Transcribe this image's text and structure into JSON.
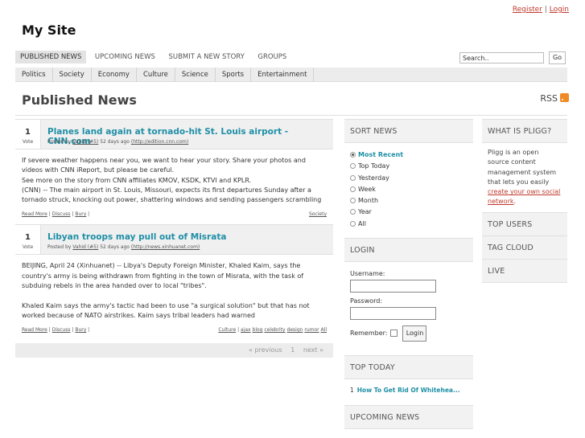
{
  "header": {
    "register_label": "Register",
    "separator": "|",
    "login_label": "Login",
    "site_name": "My Site"
  },
  "nav": {
    "items": [
      {
        "label": "PUBLISHED NEWS",
        "active": true
      },
      {
        "label": "UPCOMING NEWS",
        "active": false
      },
      {
        "label": "SUBMIT A NEW STORY",
        "active": false
      },
      {
        "label": "GROUPS",
        "active": false
      }
    ]
  },
  "search": {
    "value": "Search..",
    "go_label": "Go"
  },
  "categories": [
    "Politics",
    "Society",
    "Economy",
    "Culture",
    "Science",
    "Sports",
    "Entertainment"
  ],
  "page": {
    "title": "Published News",
    "rss_label": "RSS"
  },
  "stories": [
    {
      "votes": "1",
      "vote_label": "Vote",
      "title": "Planes land again at tornado-hit St. Louis airport - CNN.com",
      "meta_prefix": "Posted by",
      "author": "Vahid (#5)",
      "meta_time": "52 days ago",
      "source": "(http://edition.cnn.com)",
      "body": [
        "If severe weather happens near you, we want to hear your story. Share your photos and videos with CNN iReport, but please be careful.",
        "See more on the story from CNN affiliates KMOV, KSDK, KTVI and KPLR.",
        "(CNN) -- The main airport in St. Louis, Missouri, expects its first departures Sunday after a tornado struck, knocking out power, shattering windows and sending passengers scrambling for cover f"
      ],
      "links": [
        "Read More",
        "Discuss",
        "Bury"
      ],
      "right_links": [
        "Society"
      ]
    },
    {
      "votes": "1",
      "vote_label": "Vote",
      "title": "Libyan troops may pull out of Misrata",
      "meta_prefix": "Posted by",
      "author": "Vahid (#5)",
      "meta_time": "52 days ago",
      "source": "(http://news.xinhuanet.com)",
      "body": [
        "BEIJING, April 24 (Xinhuanet) -- Libya's Deputy Foreign Minister, Khaled Kaim, says the country's army is being withdrawn from fighting in the town of Misrata, with the task of subduing rebels in the area handed over to local \"tribes\".",
        "",
        "Khaled Kaim says the army's tactic had been to use \"a surgical solution\" but that has not worked because of NATO airstrikes. Kaim says tribal leaders had warned"
      ],
      "links": [
        "Read More",
        "Discuss",
        "Bury"
      ],
      "right_links": [
        "Culture",
        "ajax",
        "blog",
        "celebrity",
        "design",
        "rumor",
        "All"
      ]
    }
  ],
  "pager": {
    "prev": "« previous",
    "page": "1",
    "next": "next »"
  },
  "sort": {
    "title": "SORT NEWS",
    "options": [
      {
        "label": "Most Recent",
        "selected": true
      },
      {
        "label": "Top Today",
        "selected": false
      },
      {
        "label": "Yesterday",
        "selected": false
      },
      {
        "label": "Week",
        "selected": false
      },
      {
        "label": "Month",
        "selected": false
      },
      {
        "label": "Year",
        "selected": false
      },
      {
        "label": "All",
        "selected": false
      }
    ]
  },
  "login": {
    "title": "LOGIN",
    "username_label": "Username:",
    "password_label": "Password:",
    "remember_label": "Remember:",
    "button_label": "Login"
  },
  "top_today": {
    "title": "TOP TODAY",
    "items": [
      {
        "rank": "1",
        "label": "How To Get Rid Of Whitehea..."
      }
    ]
  },
  "upcoming": {
    "title": "UPCOMING NEWS"
  },
  "about": {
    "title": "WHAT IS PLIGG?",
    "text": "Pligg is an open source content management system that lets you easily",
    "link": "create your own social network",
    "end": "."
  },
  "side_boxes": [
    "TOP USERS",
    "TAG CLOUD",
    "LIVE"
  ],
  "colors": {
    "accent": "#1f8fa6",
    "link_red": "#c0392b",
    "rss": "#f08a24"
  }
}
